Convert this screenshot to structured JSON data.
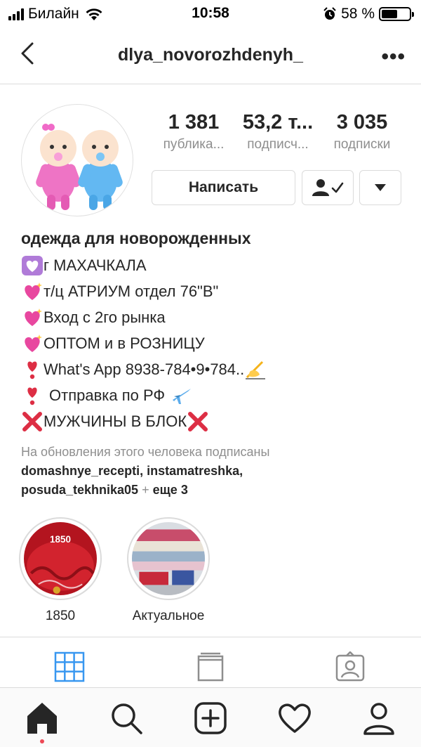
{
  "status_bar": {
    "carrier": "Билайн",
    "time": "10:58",
    "battery_text": "58 %",
    "battery_level": 0.58
  },
  "header": {
    "username": "dlya_novorozhdenyh_",
    "back_icon": "chevron-left-icon",
    "more_icon": "more-horizontal-icon"
  },
  "profile": {
    "stats": [
      {
        "value": "1 381",
        "label": "публика..."
      },
      {
        "value": "53,2 т...",
        "label": "подписч..."
      },
      {
        "value": "3 035",
        "label": "подписки"
      }
    ],
    "message_button": "Написать",
    "following_icon": "person-check-icon",
    "dropdown_icon": "caret-down-icon"
  },
  "bio": {
    "name": "одежда для новорожденных",
    "lines": [
      {
        "emoji": "purple-heart",
        "text": "г МАХАЧКАЛА"
      },
      {
        "emoji": "sparkling-heart",
        "text": "т/ц АТРИУМ отдел 76\"В\""
      },
      {
        "emoji": "sparkling-heart",
        "text": "Вход с 2го рынка"
      },
      {
        "emoji": "sparkling-heart",
        "text": "ОПТОМ и в РОЗНИЦУ"
      },
      {
        "emoji": "heart-exclamation",
        "text": "What's App 8938-784•9•784..",
        "trailing_emoji": "writing-hand"
      },
      {
        "emoji": "heart-exclamation",
        "text": "Отправка по РФ",
        "trailing_emoji": "airplane"
      },
      {
        "emoji": "cross-mark",
        "text": "МУЖЧИНЫ В БЛОК",
        "trailing_emoji": "cross-mark"
      }
    ],
    "followed_by_prefix": "На обновления этого человека подписаны",
    "followed_by_users": "domashnye_recepti, instamatreshka,",
    "followed_by_users2": "posuda_tekhnika05",
    "followed_by_more": "+ еще 3"
  },
  "highlights": [
    {
      "label": "1850",
      "badge": "1850"
    },
    {
      "label": "Актуальное"
    }
  ],
  "tabs": [
    {
      "icon": "grid-icon",
      "active": true
    },
    {
      "icon": "feed-icon",
      "active": false
    },
    {
      "icon": "tagged-icon",
      "active": false
    }
  ],
  "bottom_nav": [
    {
      "icon": "home-icon"
    },
    {
      "icon": "search-icon"
    },
    {
      "icon": "add-post-icon"
    },
    {
      "icon": "heart-icon"
    },
    {
      "icon": "profile-icon"
    }
  ],
  "colors": {
    "accent_blue": "#3897f0",
    "text": "#262626",
    "muted": "#8e8e8e",
    "border": "#dbdbdb",
    "notification_dot": "#ed4956"
  }
}
